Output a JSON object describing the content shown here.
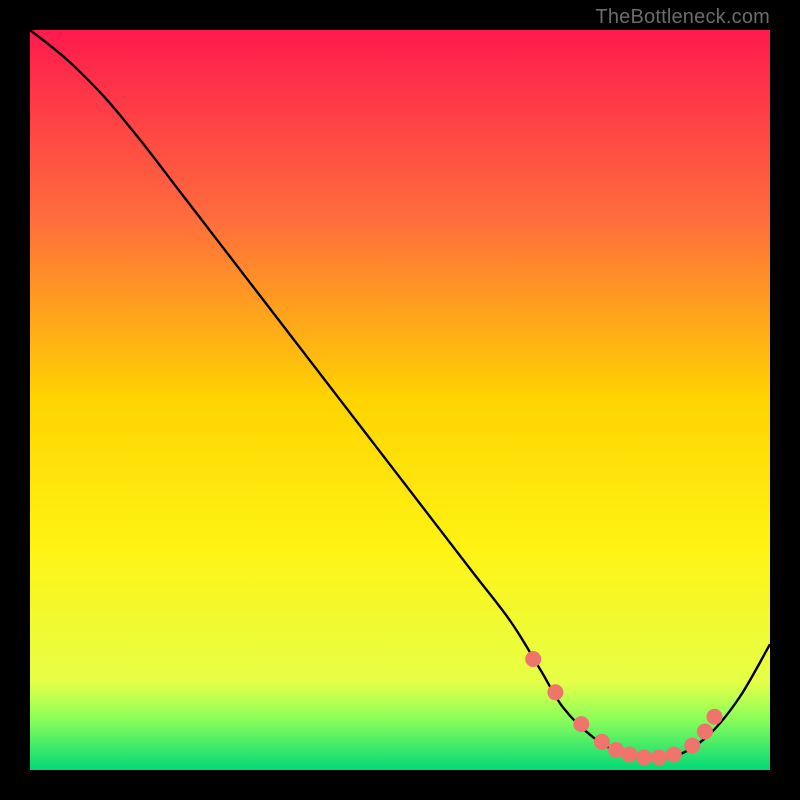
{
  "attribution": "TheBottleneck.com",
  "chart_data": {
    "type": "line",
    "title": "",
    "xlabel": "",
    "ylabel": "",
    "xlim": [
      0,
      100
    ],
    "ylim": [
      0,
      100
    ],
    "background_gradient_stops": [
      {
        "offset": 0.0,
        "color": "#ff1a4d"
      },
      {
        "offset": 0.25,
        "color": "#ff6b3d"
      },
      {
        "offset": 0.5,
        "color": "#ffd400"
      },
      {
        "offset": 0.7,
        "color": "#fff314"
      },
      {
        "offset": 0.88,
        "color": "#e6ff46"
      },
      {
        "offset": 0.93,
        "color": "#8eff5a"
      },
      {
        "offset": 1.0,
        "color": "#00d976"
      }
    ],
    "series": [
      {
        "name": "curve",
        "x": [
          0,
          5,
          10,
          15,
          20,
          25,
          30,
          35,
          40,
          45,
          50,
          55,
          60,
          65,
          69,
          72,
          76,
          80,
          84,
          88,
          92,
          96,
          100
        ],
        "y": [
          100,
          96,
          91,
          85,
          78.5,
          72,
          65.5,
          59,
          52.5,
          46,
          39.5,
          33,
          26.5,
          20,
          13.5,
          8.5,
          4.5,
          2.2,
          1.5,
          2.2,
          5,
          10,
          17
        ]
      }
    ],
    "markers": {
      "name": "highlight-points",
      "color": "#ef746c",
      "radius_px": 8,
      "x": [
        68,
        71,
        74.5,
        77.3,
        79.2,
        81,
        83,
        85,
        87,
        89.5,
        91.2,
        92.5
      ],
      "y": [
        15,
        10.5,
        6.2,
        3.8,
        2.7,
        2.1,
        1.7,
        1.7,
        2.1,
        3.3,
        5.2,
        7.2
      ]
    }
  }
}
